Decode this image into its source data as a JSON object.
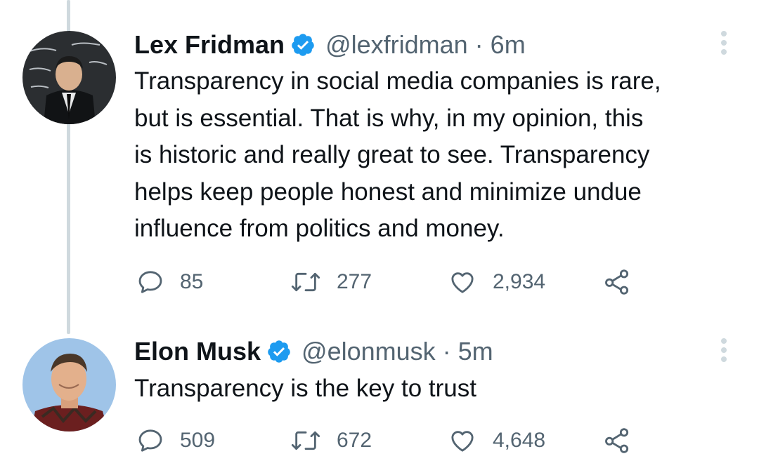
{
  "thread": {
    "tweets": [
      {
        "author_name": "Lex Fridman",
        "handle": "@lexfridman",
        "separator": "·",
        "time": "6m",
        "verified": true,
        "text_lines": [
          "Transparency in social media companies is rare,",
          "but is essential. That is why, in my opinion, this",
          "is historic and really great to see. Transparency",
          "helps keep people honest and minimize undue",
          "influence from politics and money."
        ],
        "counts": {
          "replies": "85",
          "retweets": "277",
          "likes": "2,934"
        }
      },
      {
        "author_name": "Elon Musk",
        "handle": "@elonmusk",
        "separator": "·",
        "time": "5m",
        "verified": true,
        "text_lines": [
          "Transparency is the key to trust"
        ],
        "counts": {
          "replies": "509",
          "retweets": "672",
          "likes": "4,648"
        }
      }
    ]
  },
  "icons": {
    "verified": "verified-badge-icon",
    "reply": "reply-icon",
    "retweet": "retweet-icon",
    "like": "heart-icon",
    "share": "share-icon",
    "more": "more-vertical-icon"
  },
  "colors": {
    "verified_blue": "#1d9bf0",
    "secondary_text": "#536471",
    "thread_line": "#cfd9de"
  }
}
